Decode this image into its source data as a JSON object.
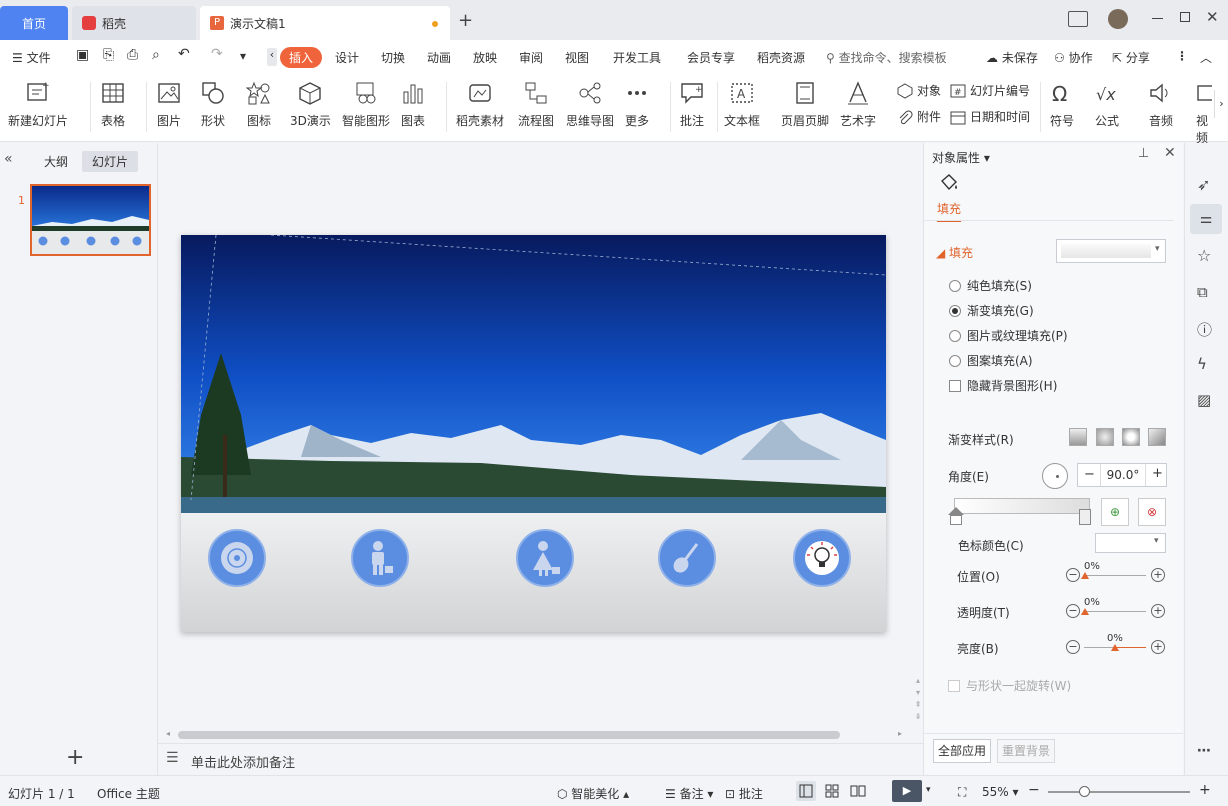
{
  "tabs": {
    "home": "首页",
    "docer": "稻壳",
    "doc": "演示文稿1"
  },
  "menu": {
    "file": "文件",
    "items": [
      "插入",
      "设计",
      "切换",
      "动画",
      "放映",
      "审阅",
      "视图",
      "开发工具",
      "会员专享",
      "稻壳资源"
    ],
    "search": "查找命令、搜索模板",
    "unsaved": "未保存",
    "collab": "协作",
    "share": "分享"
  },
  "ribbon": {
    "new_slide": "新建幻灯片",
    "table": "表格",
    "picture": "图片",
    "shape": "形状",
    "icon": "图标",
    "threed": "3D演示",
    "smart": "智能图形",
    "chart": "图表",
    "docer_material": "稻壳素材",
    "flowchart": "流程图",
    "mindmap": "思维导图",
    "more": "更多",
    "comment": "批注",
    "textbox": "文本框",
    "header_footer": "页眉页脚",
    "wordart": "艺术字",
    "object": "对象",
    "slide_number": "幻灯片编号",
    "attachment": "附件",
    "datetime": "日期和时间",
    "symbol": "符号",
    "formula": "公式",
    "audio": "音频",
    "video": "视频"
  },
  "left": {
    "outline_tab": "大纲",
    "slides_tab": "幻灯片",
    "slide_index": "1"
  },
  "canvas": {
    "notes_placeholder": "单击此处添加备注"
  },
  "props": {
    "title": "对象属性",
    "fill_tab": "填充",
    "fill_section": "填充",
    "options": [
      "纯色填充(S)",
      "渐变填充(G)",
      "图片或纹理填充(P)",
      "图案填充(A)"
    ],
    "selected_option": 1,
    "hide_bg": "隐藏背景图形(H)",
    "gradient_style": "渐变样式(R)",
    "angle_label": "角度(E)",
    "angle_value": "90.0°",
    "stop_color": "色标颜色(C)",
    "position": "位置(O)",
    "position_value": "0%",
    "transparency": "透明度(T)",
    "transparency_value": "0%",
    "brightness": "亮度(B)",
    "brightness_value": "0%",
    "rotate_with_shape": "与形状一起旋转(W)",
    "apply_all": "全部应用",
    "reset_bg": "重置背景"
  },
  "status": {
    "slide_count": "幻灯片 1 / 1",
    "theme": "Office 主题",
    "beautify": "智能美化",
    "notes": "备注",
    "comment": "批注",
    "zoom": "55%"
  },
  "colors": {
    "accent": "#f0643c",
    "home_tab": "#4f83f1",
    "slide_icon": "#5b8ee0"
  }
}
